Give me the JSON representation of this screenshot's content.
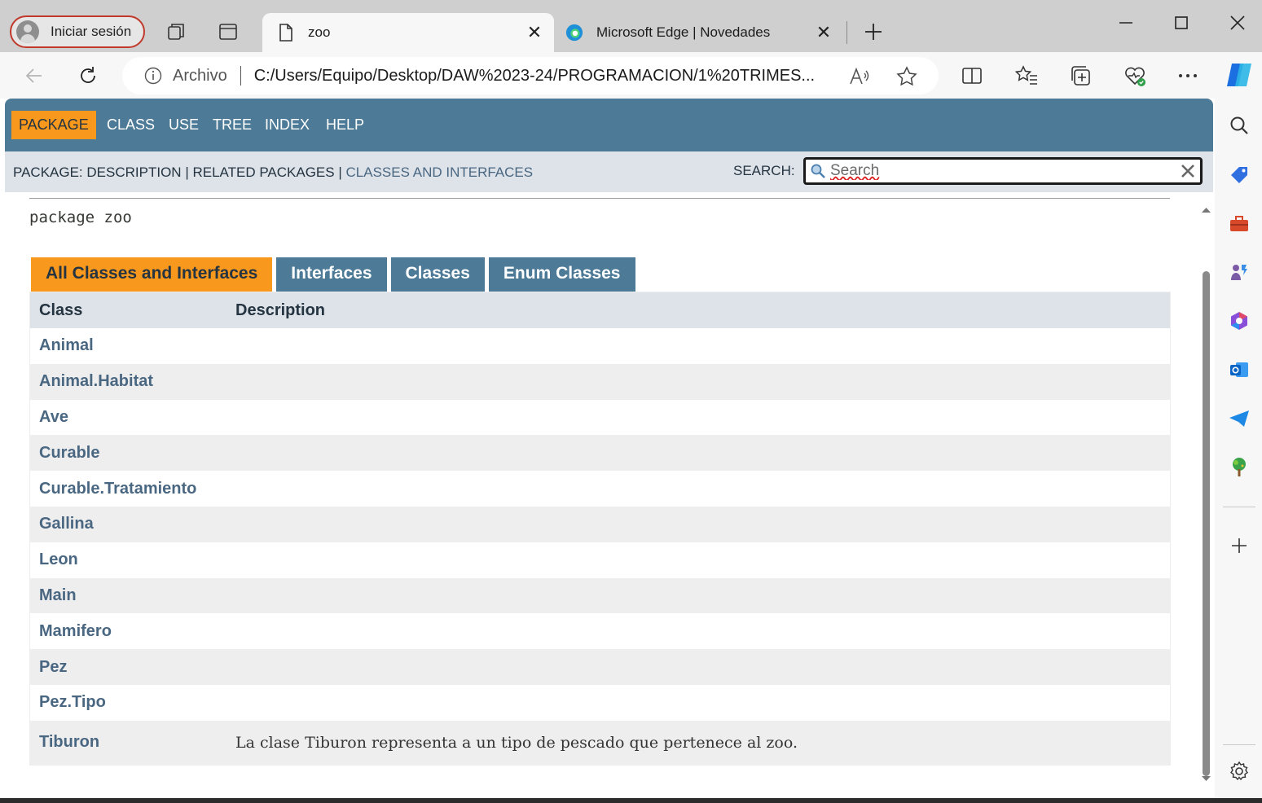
{
  "browser": {
    "profile_label": "Iniciar sesión",
    "tabs": [
      {
        "title": "zoo",
        "active": true
      },
      {
        "title": "Microsoft Edge | Novedades",
        "active": false
      }
    ],
    "address": {
      "security_label": "Archivo",
      "url": "C:/Users/Equipo/Desktop/DAW%2023-24/PROGRAMACION/1%20TRIMES..."
    }
  },
  "javadoc": {
    "nav": [
      "PACKAGE",
      "CLASS",
      "USE",
      "TREE",
      "INDEX",
      "HELP"
    ],
    "subnav": {
      "prefix": "PACKAGE:",
      "description": "DESCRIPTION",
      "related": "RELATED PACKAGES",
      "classes": "CLASSES AND INTERFACES",
      "separator": "|"
    },
    "search": {
      "label": "SEARCH:",
      "placeholder": "Search"
    },
    "package_title": "package zoo",
    "class_tabs": [
      "All Classes and Interfaces",
      "Interfaces",
      "Classes",
      "Enum Classes"
    ],
    "table": {
      "headers": [
        "Class",
        "Description"
      ],
      "rows": [
        {
          "name": "Animal",
          "desc": ""
        },
        {
          "name": "Animal.Habitat",
          "desc": ""
        },
        {
          "name": "Ave",
          "desc": ""
        },
        {
          "name": "Curable",
          "desc": ""
        },
        {
          "name": "Curable.Tratamiento",
          "desc": ""
        },
        {
          "name": "Gallina",
          "desc": ""
        },
        {
          "name": "Leon",
          "desc": ""
        },
        {
          "name": "Main",
          "desc": ""
        },
        {
          "name": "Mamifero",
          "desc": ""
        },
        {
          "name": "Pez",
          "desc": ""
        },
        {
          "name": "Pez.Tipo",
          "desc": ""
        },
        {
          "name": "Tiburon",
          "desc": "La clase Tiburon representa a un tipo de pescado que pertenece al zoo."
        }
      ]
    }
  },
  "colors": {
    "nav_bg": "#4d7a97",
    "active_orange": "#f8981d",
    "subnav_bg": "#dee3e9",
    "link": "#4a6782"
  }
}
